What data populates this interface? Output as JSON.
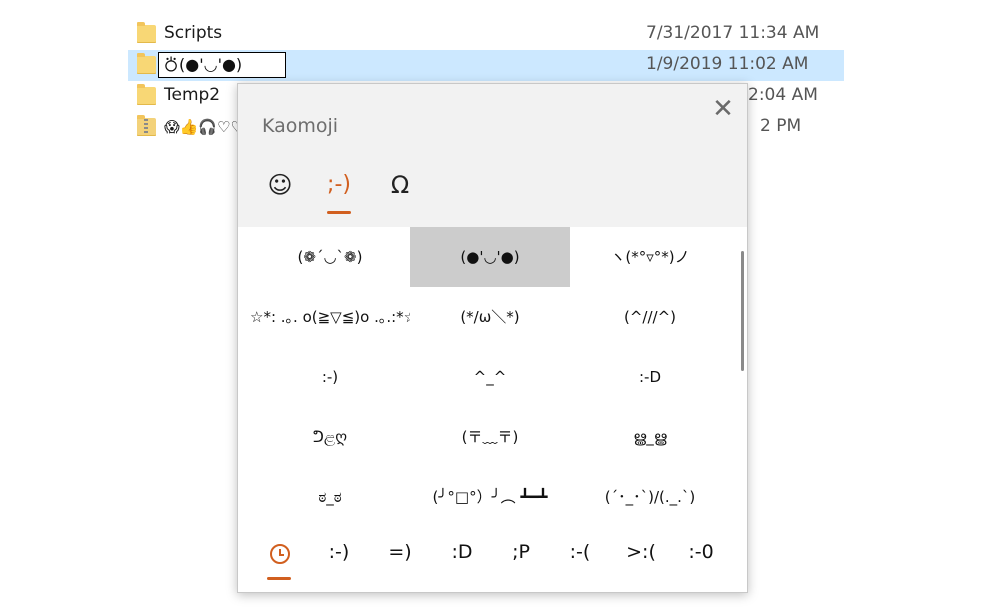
{
  "explorer": {
    "rows": [
      {
        "name": "Scripts",
        "date": "7/31/2017 11:34 AM"
      },
      {
        "name": "⛣(●'◡'●)",
        "date": "1/9/2019 11:02 AM"
      },
      {
        "name": "Temp2",
        "date": "2:04 AM"
      },
      {
        "name": "😱👍🎧♡♡",
        "date": "2 PM"
      }
    ]
  },
  "panel": {
    "title": "Kaomoji",
    "close": "✕",
    "tabs": [
      {
        "label": "☺"
      },
      {
        "label": ";-)"
      },
      {
        "label": "Ω"
      }
    ],
    "grid": [
      "(❁´◡`❁)",
      "(●'◡'●)",
      "ヽ(*°▿°*)ノ",
      "☆*: .｡. o(≧▽≦)o .｡.:*☆",
      "(*/ω＼*)",
      "(^///^)",
      ":-)",
      "^_^",
      ":-D",
      "ᕤළღ",
      "(〒﹏〒)",
      "ൠ_ൠ",
      "ಠ_ಠ",
      "(╯°□°）╯︵ ┻━┻",
      "(´･_･`)/(._.`)"
    ],
    "recent": [
      ":-)",
      "=)",
      ":D",
      ";P",
      ":-(",
      ">:(",
      ":-0"
    ]
  },
  "colors": {
    "accent": "#d15f1f",
    "selection": "#cce8ff",
    "cell_selected": "#cccccc"
  }
}
